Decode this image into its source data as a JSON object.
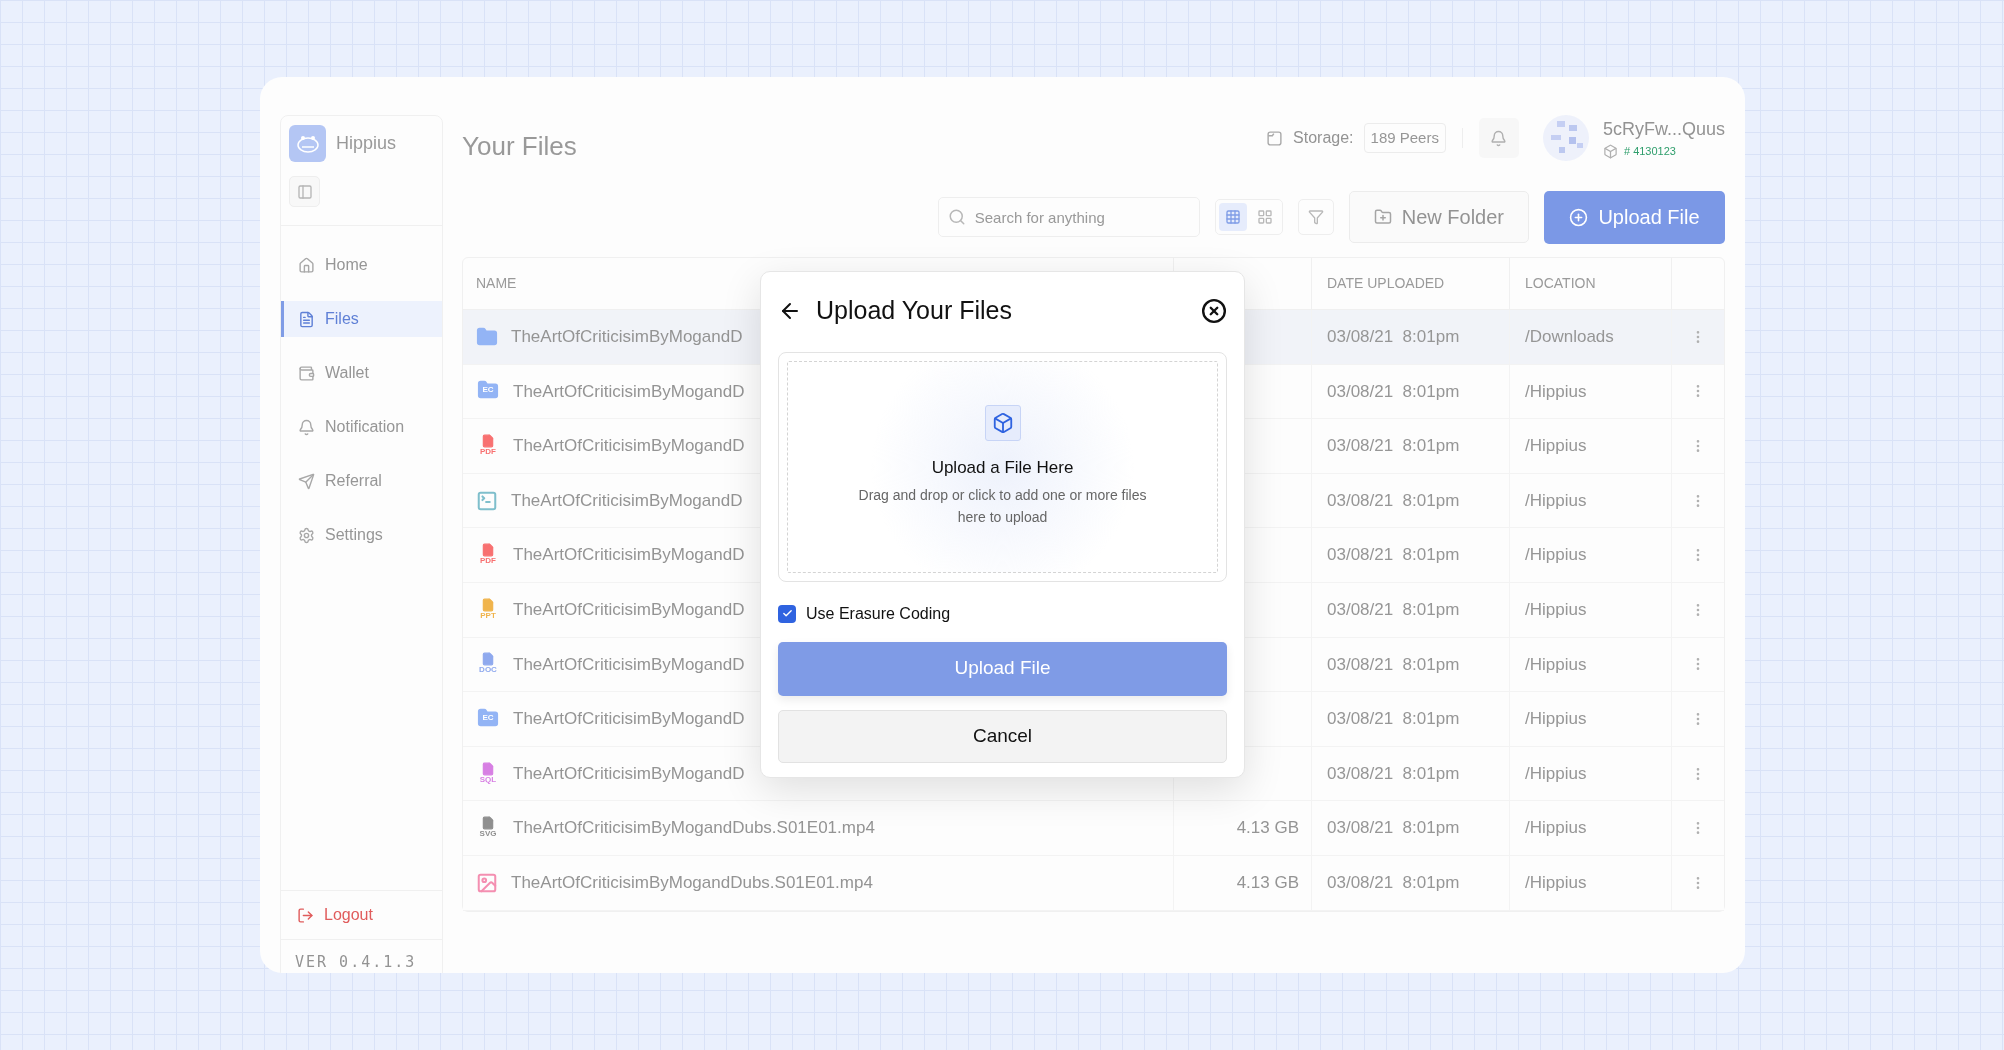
{
  "sidebar": {
    "brand": "Hippius",
    "items": [
      {
        "label": "Home",
        "selected": false
      },
      {
        "label": "Files",
        "selected": true
      },
      {
        "label": "Wallet",
        "selected": false
      },
      {
        "label": "Notification",
        "selected": false
      },
      {
        "label": "Referral",
        "selected": false
      },
      {
        "label": "Settings",
        "selected": false
      }
    ],
    "logout": "Logout",
    "version": "VER 0.4.1.3"
  },
  "header": {
    "title": "Your Files",
    "storage_label": "Storage:",
    "storage_value": "189 Peers",
    "account": "5cRyFw...Quus",
    "block": "# 4130123"
  },
  "toolbar": {
    "search": {
      "placeholder": "Search for anything"
    },
    "view_toggle": [
      {
        "selected": true
      },
      {
        "selected": false
      }
    ],
    "new_folder": "New Folder",
    "upload": "Upload File"
  },
  "table": {
    "columns": [
      "NAME",
      "DATE UPLOADED",
      "LOCATION"
    ],
    "rows": [
      {
        "selected": true,
        "kind": "folder",
        "color": "#93b4f5",
        "name": "TheArtOfCriticisimByMogandD",
        "date": "03/08/21  8:01pm",
        "location": "/Downloads"
      },
      {
        "selected": false,
        "kind": "folder-label",
        "icon_label": "EC",
        "color": "#93b4f5",
        "name": "TheArtOfCriticisimByMogandD",
        "date": "03/08/21  8:01pm",
        "location": "/Hippius"
      },
      {
        "selected": false,
        "kind": "file-label",
        "icon_label": "PDF",
        "color": "#f87171",
        "name": "TheArtOfCriticisimByMogandD",
        "date": "03/08/21  8:01pm",
        "location": "/Hippius"
      },
      {
        "selected": false,
        "kind": "terminal",
        "color": "#7fbfcc",
        "name": "TheArtOfCriticisimByMogandD",
        "date": "03/08/21  8:01pm",
        "location": "/Hippius"
      },
      {
        "selected": false,
        "kind": "file-label",
        "icon_label": "PDF",
        "color": "#f87171",
        "name": "TheArtOfCriticisimByMogandD",
        "date": "03/08/21  8:01pm",
        "location": "/Hippius"
      },
      {
        "selected": false,
        "kind": "file-label",
        "icon_label": "PPT",
        "color": "#f0b44c",
        "name": "TheArtOfCriticisimByMogandD",
        "date": "03/08/21  8:01pm",
        "location": "/Hippius"
      },
      {
        "selected": false,
        "kind": "file-label",
        "icon_label": "DOC",
        "color": "#8fa9ee",
        "name": "TheArtOfCriticisimByMogandD",
        "date": "03/08/21  8:01pm",
        "location": "/Hippius"
      },
      {
        "selected": false,
        "kind": "folder-label",
        "icon_label": "EC",
        "color": "#93b4f5",
        "name": "TheArtOfCriticisimByMogandD",
        "date": "03/08/21  8:01pm",
        "location": "/Hippius"
      },
      {
        "selected": false,
        "kind": "file-label",
        "icon_label": "SQL",
        "color": "#d77fe3",
        "name": "TheArtOfCriticisimByMogandD",
        "date": "03/08/21  8:01pm",
        "location": "/Hippius"
      },
      {
        "selected": false,
        "kind": "file-label",
        "icon_label": "SVG",
        "color": "#8f8f8f",
        "name": "TheArtOfCriticisimByMogandDubs.S01E01.mp4",
        "size": "4.13 GB",
        "date": "03/08/21  8:01pm",
        "location": "/Hippius"
      },
      {
        "selected": false,
        "kind": "image",
        "color": "#f48fb1",
        "name": "TheArtOfCriticisimByMogandDubs.S01E01.mp4",
        "size": "4.13 GB",
        "date": "03/08/21  8:01pm",
        "location": "/Hippius"
      }
    ]
  },
  "modal": {
    "title": "Upload Your Files",
    "drop_title": "Upload a File Here",
    "drop_hint": "Drag and drop or click to add one or more files here to upload",
    "erasure_coding": {
      "label": "Use Erasure Coding",
      "checked": true
    },
    "upload_button": {
      "label": "Upload File",
      "disabled": true
    },
    "cancel": "Cancel"
  }
}
